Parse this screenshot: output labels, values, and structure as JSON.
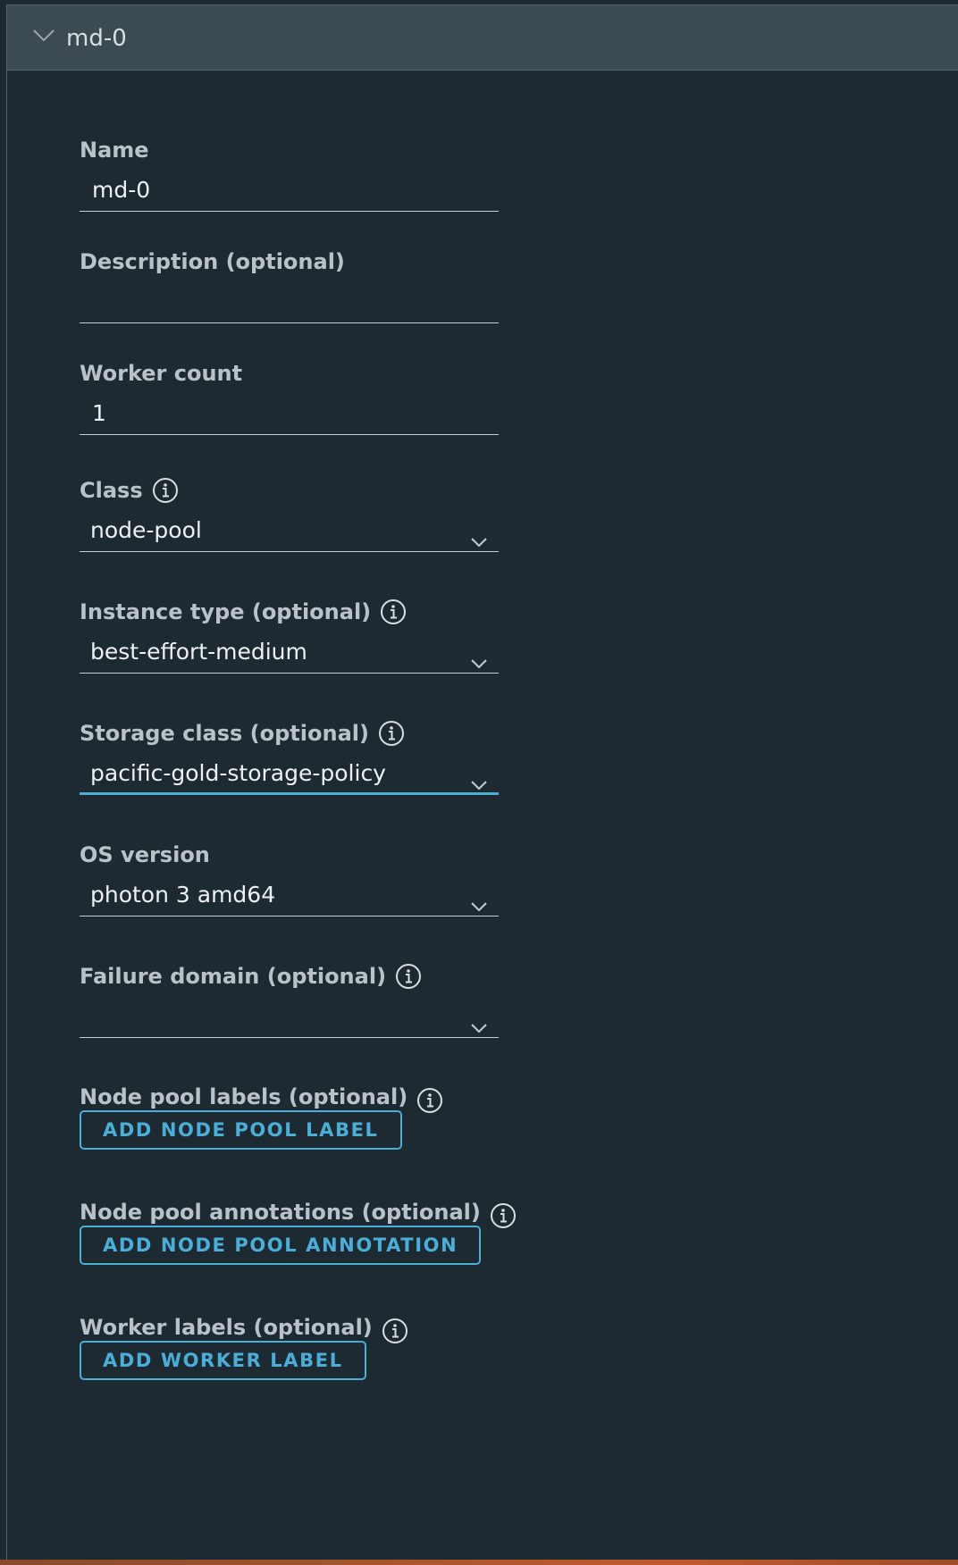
{
  "header": {
    "title": "md-0"
  },
  "form": {
    "name": {
      "label": "Name",
      "value": "md-0"
    },
    "description": {
      "label": "Description (optional)",
      "value": ""
    },
    "worker_count": {
      "label": "Worker count",
      "value": "1"
    },
    "class": {
      "label": "Class",
      "value": "node-pool"
    },
    "instance_type": {
      "label": "Instance type (optional)",
      "value": "best-effort-medium"
    },
    "storage_class": {
      "label": "Storage class (optional)",
      "value": "pacific-gold-storage-policy"
    },
    "os_version": {
      "label": "OS version",
      "value": "photon 3 amd64"
    },
    "failure_domain": {
      "label": "Failure domain (optional)",
      "value": ""
    },
    "node_pool_labels": {
      "label": "Node pool labels (optional)",
      "button": "ADD NODE POOL LABEL"
    },
    "node_pool_annotations": {
      "label": "Node pool annotations (optional)",
      "button": "ADD NODE POOL ANNOTATION"
    },
    "worker_labels": {
      "label": "Worker labels (optional)",
      "button": "ADD WORKER LABEL"
    }
  },
  "colors": {
    "background": "#1e2a32",
    "header": "#3c4a52",
    "accent": "#49afd9",
    "label": "#b9c2c8",
    "text": "#eef1f3"
  }
}
